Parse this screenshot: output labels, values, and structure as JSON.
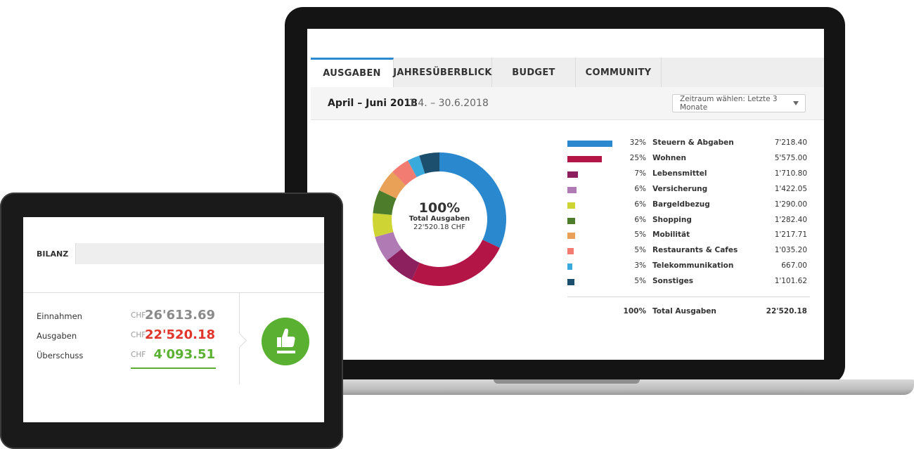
{
  "laptop": {
    "tabs": [
      {
        "label": "AUSGABEN",
        "active": true
      },
      {
        "label": "JAHRESÜBERBLICK",
        "active": false
      },
      {
        "label": "BUDGET",
        "active": false
      },
      {
        "label": "COMMUNITY",
        "active": false
      }
    ],
    "period": {
      "title": "April – Juni 2018",
      "range": "1.4. – 30.6.2018"
    },
    "select": {
      "label": "Zeitraum wählen: Letzte 3 Monate"
    },
    "donut": {
      "percent": "100%",
      "label": "Total Ausgaben",
      "total": "22'520.18 CHF"
    },
    "legend_total": {
      "pct": "100%",
      "category": "Total Ausgaben",
      "value": "22'520.18"
    }
  },
  "chart_data": {
    "type": "pie",
    "title": "",
    "categories": [
      "Steuern & Abgaben",
      "Wohnen",
      "Lebensmittel",
      "Versicherung",
      "Bargeldbezug",
      "Shopping",
      "Mobilität",
      "Restaurants & Cafes",
      "Telekommunikation",
      "Sonstiges"
    ],
    "percent_labels": [
      "32%",
      "25%",
      "7%",
      "6%",
      "6%",
      "6%",
      "5%",
      "5%",
      "3%",
      "5%"
    ],
    "value_labels": [
      "7'218.40",
      "5'575.00",
      "1'710.80",
      "1'422.05",
      "1'290.00",
      "1'282.40",
      "1'217.71",
      "1'035.20",
      "667.00",
      "1'101.62"
    ],
    "values": [
      7218.4,
      5575.0,
      1710.8,
      1422.05,
      1290.0,
      1282.4,
      1217.71,
      1035.2,
      667.0,
      1101.62
    ],
    "colors": [
      "#2a88cf",
      "#b31646",
      "#8c1f5e",
      "#b07ab5",
      "#cfd435",
      "#4d7c2b",
      "#e8a157",
      "#f27c72",
      "#3aa9dc",
      "#1c4f6d"
    ]
  },
  "tablet": {
    "tab_label": "BILANZ",
    "rows": [
      {
        "label": "Einnahmen",
        "currency": "CHF",
        "amount": "26'613.69",
        "color": "#8a8a8a"
      },
      {
        "label": "Ausgaben",
        "currency": "CHF",
        "amount": "22'520.18",
        "color": "#e0352b"
      },
      {
        "label": "Überschuss",
        "currency": "CHF",
        "amount": "4'093.51",
        "color": "#5ab030"
      }
    ],
    "icon": "thumbs-up-icon"
  }
}
